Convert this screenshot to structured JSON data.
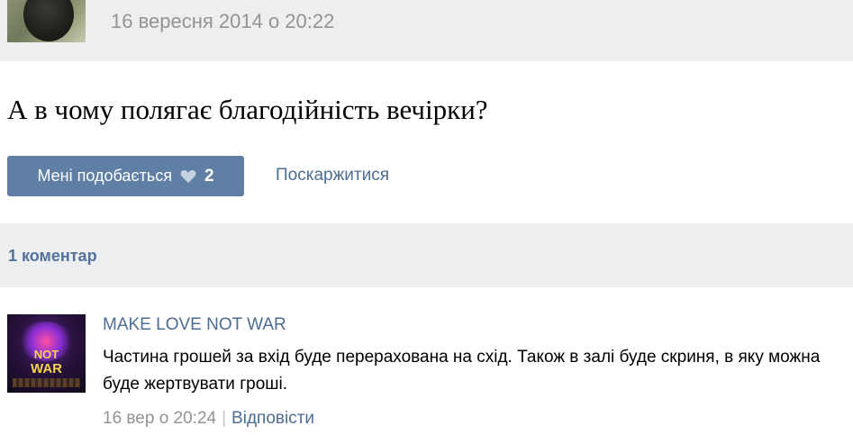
{
  "post": {
    "date": "16 вересня 2014 о 20:22",
    "text": "А в чому полягає благодійність вечірки?",
    "like_label": "Мені подобається",
    "like_count": "2",
    "report_label": "Поскаржитися"
  },
  "comments": {
    "count_label": "1 коментар",
    "items": [
      {
        "author": "MAKE LOVE NOT WAR",
        "text": "Частина грошей за вхід буде перерахована на схід. Також в залі буде скриня, в яку можна буде жертвувати гроші.",
        "date": "16 вер о 20:24",
        "separator": "|",
        "reply_label": "Відповісти",
        "avatar_lettering": [
          "",
          "NOT",
          "WAR"
        ]
      }
    ]
  },
  "colors": {
    "band_bg": "#edeef0",
    "like_button_bg": "#5f7fa5",
    "link": "#4d6d91",
    "muted": "#939393"
  }
}
